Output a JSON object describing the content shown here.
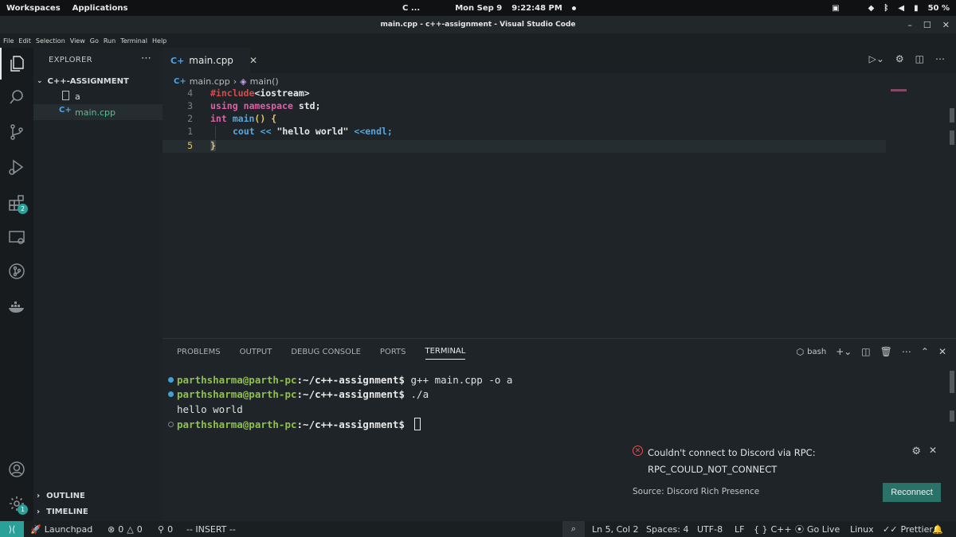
{
  "system_bar": {
    "workspaces": "Workspaces",
    "applications": "Applications",
    "indicator": "C ...",
    "date": "Mon Sep 9",
    "time": "9:22:48 PM",
    "battery": "50 %"
  },
  "window": {
    "title": "main.cpp - c++-assignment - Visual Studio Code"
  },
  "menu": [
    "File",
    "Edit",
    "Selection",
    "View",
    "Go",
    "Run",
    "Terminal",
    "Help"
  ],
  "activity_bar": {
    "extensions_badge": "2",
    "settings_badge": "1"
  },
  "explorer": {
    "title": "EXPLORER",
    "folder": "C++-ASSIGNMENT",
    "files": [
      {
        "name": "a"
      },
      {
        "name": "main.cpp"
      }
    ],
    "outline": "OUTLINE",
    "timeline": "TIMELINE"
  },
  "editor": {
    "tab": "main.cpp",
    "breadcrumb_file": "main.cpp",
    "breadcrumb_symbol": "main()",
    "line_numbers": [
      "4",
      "3",
      "2",
      "1",
      "5"
    ],
    "code": {
      "l1_directive": "#include",
      "l1_header": "<iostream>",
      "l2_using": "using",
      "l2_namespace": "namespace",
      "l2_std": "std;",
      "l3_int": "int",
      "l3_main": "main",
      "l3_parens": "()",
      "l3_brace": "{",
      "l4_cout": "cout",
      "l4_op": "<<",
      "l4_str": "\"hello world\"",
      "l4_endl": "<<endl;",
      "l5_brace": "}"
    }
  },
  "panel": {
    "tabs": [
      "PROBLEMS",
      "OUTPUT",
      "DEBUG CONSOLE",
      "PORTS",
      "TERMINAL"
    ],
    "shell": "bash",
    "terminal": [
      {
        "user": "parthsharma@parth-pc",
        "path": ":~/c++-assignment",
        "prompt": "$ ",
        "cmd": "g++ main.cpp -o a"
      },
      {
        "user": "parthsharma@parth-pc",
        "path": ":~/c++-assignment",
        "prompt": "$ ",
        "cmd": "./a"
      },
      {
        "output": "hello world"
      },
      {
        "user": "parthsharma@parth-pc",
        "path": ":~/c++-assignment",
        "prompt": "$ ",
        "cmd": ""
      }
    ]
  },
  "notification": {
    "message_line1": "Couldn't connect to Discord via RPC:",
    "message_line2": "RPC_COULD_NOT_CONNECT",
    "source": "Source: Discord Rich Presence",
    "action": "Reconnect"
  },
  "status_bar": {
    "launchpad": "Launchpad",
    "errors": "0",
    "warnings": "0",
    "ports": "0",
    "mode": "-- INSERT --",
    "cursor": "Ln 5, Col 2",
    "spaces": "Spaces: 4",
    "encoding": "UTF-8",
    "eol": "LF",
    "language": "C++",
    "golive": "Go Live",
    "os": "Linux",
    "prettier": "Prettier"
  }
}
